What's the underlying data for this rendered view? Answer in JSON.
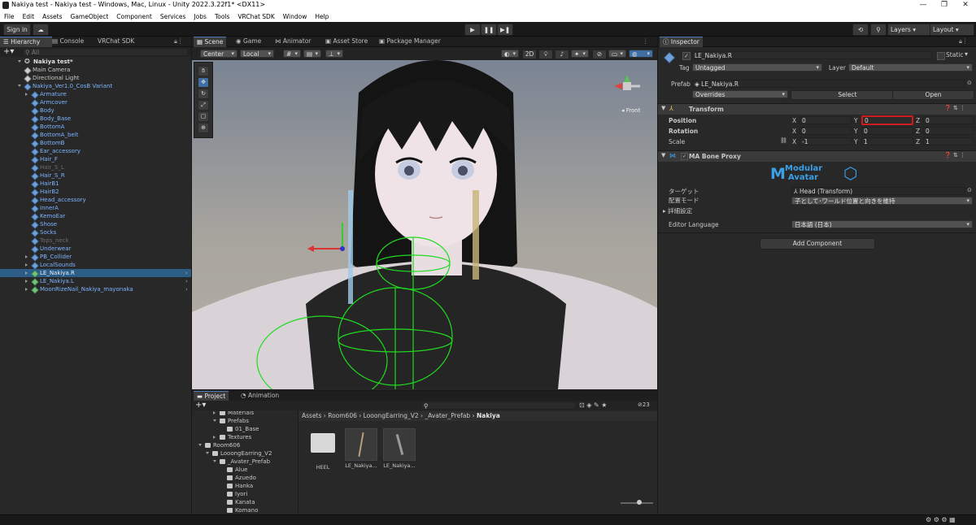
{
  "window": {
    "title": "Nakiya test - Nakiya test - Windows, Mac, Linux - Unity 2022.3.22f1* <DX11>"
  },
  "menu": [
    "File",
    "Edit",
    "Assets",
    "GameObject",
    "Component",
    "Services",
    "Jobs",
    "Tools",
    "VRChat SDK",
    "Window",
    "Help"
  ],
  "toolbar": {
    "sign_in": "Sign in",
    "layers": "Layers",
    "layout": "Layout"
  },
  "hierarchy": {
    "tabs": [
      "Hierarchy",
      "Console",
      "VRChat SDK"
    ],
    "search_placeholder": "All",
    "scene": "Nakiya test*",
    "items": [
      {
        "label": "Main Camera",
        "indent": 2,
        "style": "normal",
        "arrow": "none",
        "icon": "cube-white"
      },
      {
        "label": "Directional Light",
        "indent": 2,
        "style": "normal",
        "arrow": "none",
        "icon": "cube-white"
      },
      {
        "label": "Nakiya_Ver1.0_CosB Variant",
        "indent": 2,
        "style": "blue",
        "arrow": "down",
        "icon": "cube-blue"
      },
      {
        "label": "Armature",
        "indent": 3,
        "style": "blue",
        "arrow": "right",
        "icon": "cube-blue"
      },
      {
        "label": "Armcover",
        "indent": 3,
        "style": "blue",
        "arrow": "none",
        "icon": "cube-blue"
      },
      {
        "label": "Body",
        "indent": 3,
        "style": "blue",
        "arrow": "none",
        "icon": "cube-blue"
      },
      {
        "label": "Body_Base",
        "indent": 3,
        "style": "blue",
        "arrow": "none",
        "icon": "cube-blue"
      },
      {
        "label": "BottomA",
        "indent": 3,
        "style": "blue",
        "arrow": "none",
        "icon": "cube-blue"
      },
      {
        "label": "BottomA_belt",
        "indent": 3,
        "style": "blue",
        "arrow": "none",
        "icon": "cube-blue"
      },
      {
        "label": "BottomB",
        "indent": 3,
        "style": "blue",
        "arrow": "none",
        "icon": "cube-blue"
      },
      {
        "label": "Ear_accessory",
        "indent": 3,
        "style": "blue",
        "arrow": "none",
        "icon": "cube-blue"
      },
      {
        "label": "Hair_F",
        "indent": 3,
        "style": "blue",
        "arrow": "none",
        "icon": "cube-blue"
      },
      {
        "label": "Hair_S_L",
        "indent": 3,
        "style": "dim",
        "arrow": "none",
        "icon": "cube-blue"
      },
      {
        "label": "Hair_S_R",
        "indent": 3,
        "style": "blue",
        "arrow": "none",
        "icon": "cube-blue"
      },
      {
        "label": "HairB1",
        "indent": 3,
        "style": "blue",
        "arrow": "none",
        "icon": "cube-blue"
      },
      {
        "label": "HairB2",
        "indent": 3,
        "style": "blue",
        "arrow": "none",
        "icon": "cube-blue"
      },
      {
        "label": "Head_accessory",
        "indent": 3,
        "style": "blue",
        "arrow": "none",
        "icon": "cube-blue"
      },
      {
        "label": "InnerA",
        "indent": 3,
        "style": "blue",
        "arrow": "none",
        "icon": "cube-blue"
      },
      {
        "label": "KemoEar",
        "indent": 3,
        "style": "blue",
        "arrow": "none",
        "icon": "cube-blue"
      },
      {
        "label": "Shose",
        "indent": 3,
        "style": "blue",
        "arrow": "none",
        "icon": "cube-blue"
      },
      {
        "label": "Socks",
        "indent": 3,
        "style": "blue",
        "arrow": "none",
        "icon": "cube-blue"
      },
      {
        "label": "Tops_neck",
        "indent": 3,
        "style": "dim",
        "arrow": "none",
        "icon": "cube-blue"
      },
      {
        "label": "Underwear",
        "indent": 3,
        "style": "blue",
        "arrow": "none",
        "icon": "cube-blue"
      },
      {
        "label": "PB_Collider",
        "indent": 3,
        "style": "blue",
        "arrow": "right",
        "icon": "cube-blue"
      },
      {
        "label": "LocalSounds",
        "indent": 3,
        "style": "blue",
        "arrow": "right",
        "icon": "cube-blue"
      },
      {
        "label": "LE_Nakiya.R",
        "indent": 3,
        "style": "selected",
        "arrow": "right",
        "icon": "cube-green"
      },
      {
        "label": "LE_Nakiya.L",
        "indent": 3,
        "style": "blue",
        "arrow": "right",
        "icon": "cube-green"
      },
      {
        "label": "MoonRizeNail_Nakiya_mayonaka",
        "indent": 3,
        "style": "blue",
        "arrow": "right",
        "icon": "cube-green"
      }
    ]
  },
  "scene": {
    "tabs": [
      "Scene",
      "Game",
      "Animator",
      "Asset Store",
      "Package Manager"
    ],
    "pivot": "Center",
    "space": "Local",
    "mode_2d": "2D",
    "gizmo_label": "Front"
  },
  "project": {
    "tabs": [
      "Project",
      "Animation"
    ],
    "hidden_count": "23",
    "breadcrumb": [
      "Assets",
      "Room606",
      "LooongEarring_V2",
      "_Avater_Prefab",
      "Nakiya"
    ],
    "tree": [
      {
        "label": "Materials",
        "indent": 3,
        "arrow": "right"
      },
      {
        "label": "Prefabs",
        "indent": 3,
        "arrow": "down"
      },
      {
        "label": "01_Base",
        "indent": 4,
        "arrow": "none"
      },
      {
        "label": "Textures",
        "indent": 3,
        "arrow": "right"
      },
      {
        "label": "Room606",
        "indent": 1,
        "arrow": "down"
      },
      {
        "label": "LooongEarring_V2",
        "indent": 2,
        "arrow": "down"
      },
      {
        "label": "_Avater_Prefab",
        "indent": 3,
        "arrow": "down"
      },
      {
        "label": "Alue",
        "indent": 4,
        "arrow": "none"
      },
      {
        "label": "Azuedo",
        "indent": 4,
        "arrow": "none"
      },
      {
        "label": "Hanka",
        "indent": 4,
        "arrow": "none"
      },
      {
        "label": "Iyori",
        "indent": 4,
        "arrow": "none"
      },
      {
        "label": "Kanata",
        "indent": 4,
        "arrow": "none"
      },
      {
        "label": "Komano",
        "indent": 4,
        "arrow": "none"
      }
    ],
    "assets": [
      {
        "label": "HEEL",
        "kind": "folder"
      },
      {
        "label": "LE_Nakiya...",
        "kind": "prefab"
      },
      {
        "label": "LE_Nakiya...",
        "kind": "prefab"
      }
    ]
  },
  "inspector": {
    "tab": "Inspector",
    "object_name": "LE_Nakiya.R",
    "static_label": "Static",
    "tag_label": "Tag",
    "tag_value": "Untagged",
    "layer_label": "Layer",
    "layer_value": "Default",
    "prefab_label": "Prefab",
    "prefab_value": "LE_Nakiya.R",
    "overrides": "Overrides",
    "select": "Select",
    "open": "Open",
    "transform": {
      "title": "Transform",
      "position_label": "Position",
      "rotation_label": "Rotation",
      "scale_label": "Scale",
      "position": {
        "x": "0",
        "y": "0",
        "z": "0"
      },
      "rotation": {
        "x": "0",
        "y": "0",
        "z": "0"
      },
      "scale": {
        "x": "-1",
        "y": "1",
        "z": "1"
      },
      "axis": {
        "x": "X",
        "y": "Y",
        "z": "Z"
      }
    },
    "bone_proxy": {
      "title": "MA Bone Proxy",
      "logo_line1": "Modular",
      "logo_line2": "Avatar",
      "target_label": "ターゲット",
      "target_value": "Head (Transform)",
      "mode_label": "配置モード",
      "mode_value": "子として･ワールド位置と向きを維持",
      "details_label": "詳細設定",
      "language_label": "Editor Language",
      "language_value": "日本語 (日本)"
    },
    "add_component": "Add Component"
  },
  "colors": {
    "accent": "#2c5d87",
    "highlight_border": "#d01c1c",
    "prefab_blue": "#7db5ff",
    "logo_blue": "#3aa0e8"
  }
}
